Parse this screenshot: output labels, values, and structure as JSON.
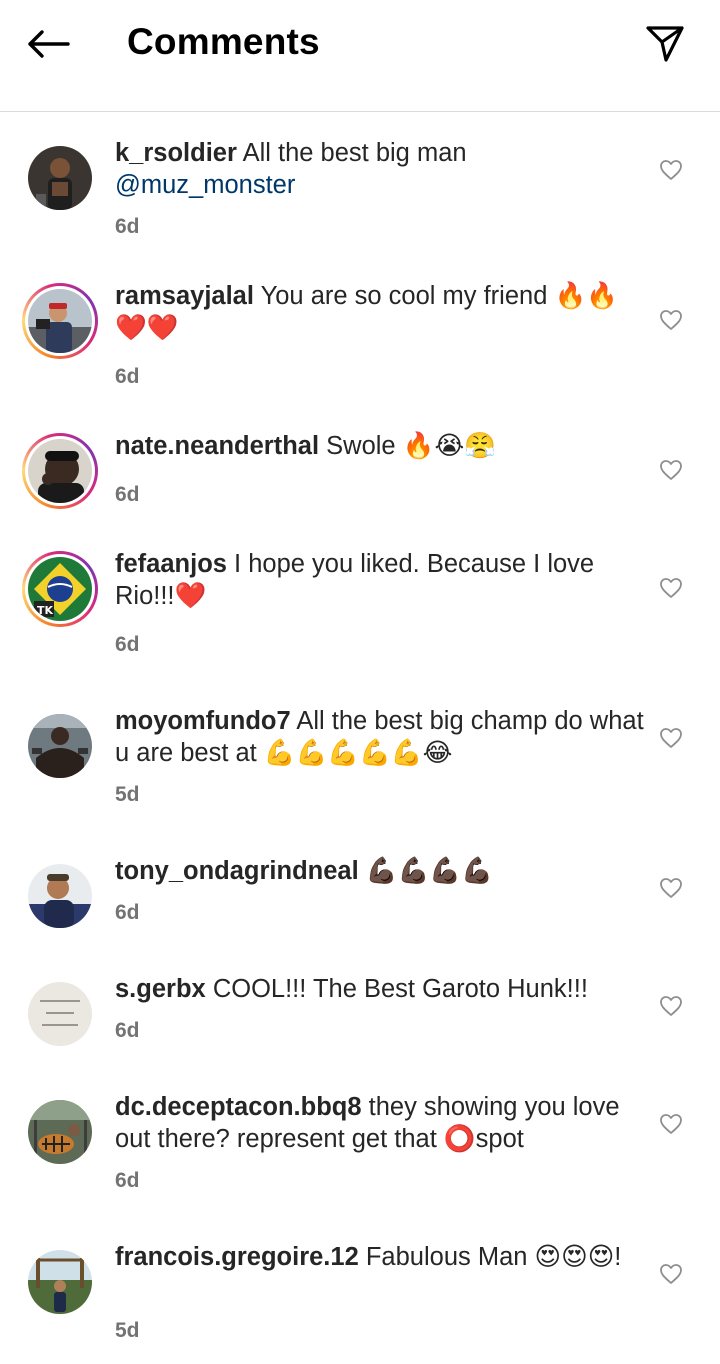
{
  "header": {
    "title": "Comments",
    "back_icon": "arrow-left-icon",
    "share_icon": "paper-plane-icon"
  },
  "comments": [
    {
      "username": "k_rsoldier",
      "text": "All the best big man",
      "mention": "@muz_monster",
      "time": "6d"
    },
    {
      "username": "ramsayjalal",
      "text": "You are so cool my friend 🔥🔥❤️❤️",
      "time": "6d"
    },
    {
      "username": "nate.neanderthal",
      "text": "Swole 🔥😭😤",
      "time": "6d"
    },
    {
      "username": "fefaanjos",
      "text": "I hope you liked. Because I love Rio!!!❤️",
      "time": "6d"
    },
    {
      "username": "moyomfundo7",
      "text": "All the best big champ do what u are best at 💪💪💪💪💪😂",
      "time": "5d"
    },
    {
      "username": "tony_ondagrindneal",
      "text": "💪🏿💪🏿💪🏿💪🏿",
      "time": "6d"
    },
    {
      "username": "s.gerbx",
      "text": "COOL!!! The Best Garoto Hunk!!!",
      "time": "6d"
    },
    {
      "username": "dc.deceptacon.bbq8",
      "text": "they showing you love out there? represent get that ⭕spot",
      "time": "6d"
    },
    {
      "username": "francois.gregoire.12",
      "text": "Fabulous Man 😍😍😍!",
      "time": "5d"
    }
  ],
  "colors": {
    "text": "#262626",
    "secondary": "#737373",
    "mention": "#00376b",
    "divider": "#dbdbdb"
  }
}
